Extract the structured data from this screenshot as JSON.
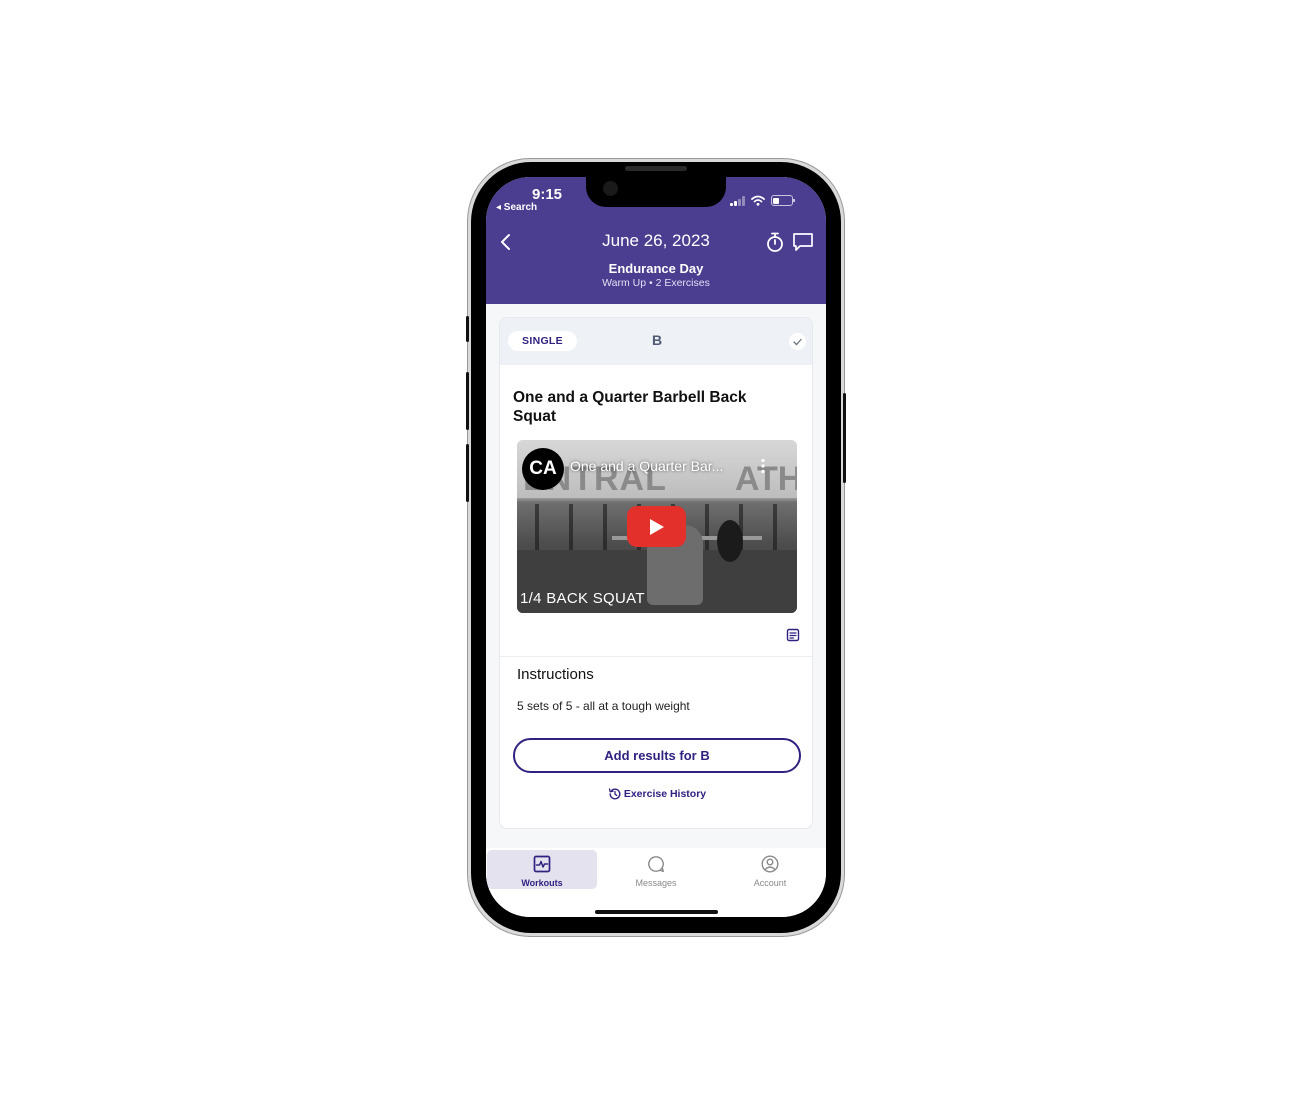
{
  "status_bar": {
    "time": "9:15",
    "back_app": "◂ Search",
    "icons": [
      "cellular-signal-icon",
      "wifi-icon",
      "battery-icon"
    ]
  },
  "header": {
    "back_icon": "chevron-left-icon",
    "title": "June 26, 2023",
    "actions": [
      "stopwatch-icon",
      "chat-bubble-icon"
    ],
    "workout_name": "Endurance Day",
    "workout_subtitle": "Warm Up • 2 Exercises"
  },
  "colors": {
    "brand_purple": "#4b3d8f",
    "accent_dark_purple": "#2f2280",
    "youtube_red": "#e3302a",
    "card_top_bg": "#eef1f5",
    "active_tab_bg": "#e4e2ef"
  },
  "card": {
    "type_badge": "SINGLE",
    "block_letter": "B",
    "completion_icon": "check-icon",
    "exercise_title": "One and a Quarter Barbell Back Squat",
    "video": {
      "channel_logo_text": "CA",
      "title": "One and a Quarter Bar...",
      "wall_text_left": "ENTRAL",
      "wall_text_right": "ATHI",
      "caption": "1/4 BACK SQUAT",
      "play_icon": "youtube-play-icon",
      "more_icon": "more-vertical-icon"
    },
    "notes_icon": "notes-icon",
    "instructions_heading": "Instructions",
    "instructions_text": "5 sets of 5 - all at a tough weight",
    "add_results_label": "Add results for B",
    "history_label": "Exercise History",
    "history_icon": "history-icon"
  },
  "tabbar": {
    "tabs": [
      {
        "label": "Workouts",
        "icon": "workouts-chart-icon",
        "active": true
      },
      {
        "label": "Messages",
        "icon": "message-bubble-icon",
        "active": false
      },
      {
        "label": "Account",
        "icon": "account-circle-icon",
        "active": false
      }
    ]
  }
}
